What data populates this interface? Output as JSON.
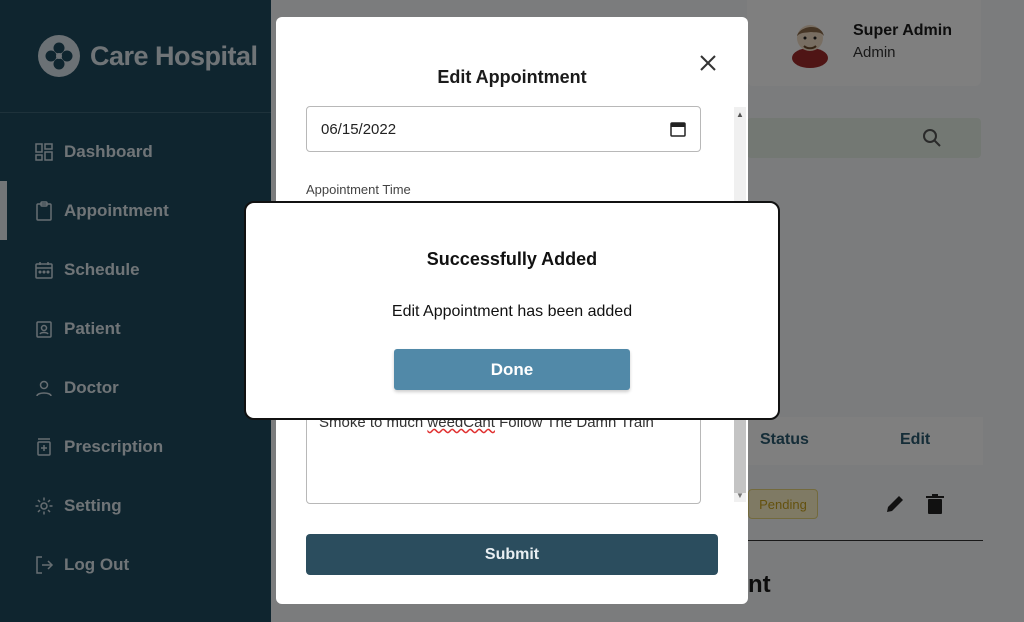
{
  "brand": {
    "name": "Care Hospital",
    "logo_icon": "clover-logo-icon"
  },
  "sidebar": {
    "items": [
      {
        "label": "Dashboard",
        "icon": "dashboard-icon"
      },
      {
        "label": "Appointment",
        "icon": "clipboard-icon",
        "active": true
      },
      {
        "label": "Schedule",
        "icon": "calendar-icon"
      },
      {
        "label": "Patient",
        "icon": "patient-badge-icon"
      },
      {
        "label": "Doctor",
        "icon": "person-icon"
      },
      {
        "label": "Prescription",
        "icon": "prescription-icon"
      },
      {
        "label": "Setting",
        "icon": "gear-icon"
      },
      {
        "label": "Log Out",
        "icon": "logout-icon"
      }
    ]
  },
  "profile": {
    "name": "Super Admin",
    "role": "Admin"
  },
  "table": {
    "headers": {
      "status": "Status",
      "edit": "Edit"
    },
    "row": {
      "status": "Pending"
    }
  },
  "background_heading_fragment": "nt",
  "edit_modal": {
    "title": "Edit Appointment",
    "date_value": "06/15/2022",
    "time_label": "Appointment Time",
    "notes_value_pre": "Smoke to much ",
    "notes_value_misspelled": "weedCant",
    "notes_value_post": " Follow The Damn Train",
    "submit_label": "Submit"
  },
  "success_dialog": {
    "title": "Successfully Added",
    "message": "Edit Appointment has been added",
    "done_label": "Done"
  },
  "colors": {
    "sidebar_bg": "#1f4a5e",
    "submit_bg": "#2b4d5e",
    "done_bg": "#5189a8",
    "badge_bg": "#fff5c8"
  }
}
